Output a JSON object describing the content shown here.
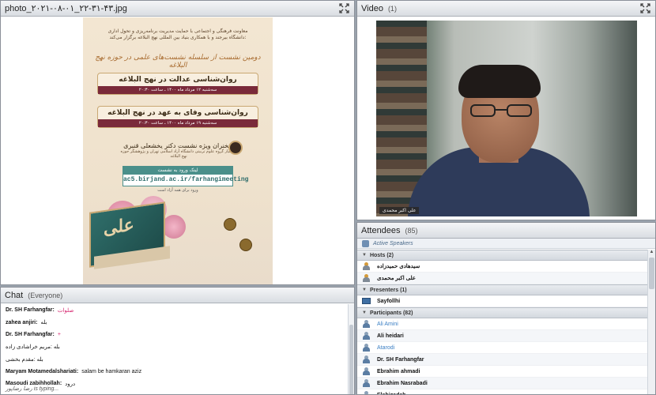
{
  "share_pod": {
    "title": "photo_۲۰۲۱-۰۸-۰۱_۲۲-۳۱-۴۳.jpg",
    "poster": {
      "header": "معاونت فرهنگی و اجتماعی با حمایت مدیریت برنامه‌ریزی و تحول اداری\nدانشگاه بیرجند و با همکاری بنیاد بین المللی نهج البلاغه برگزار می‌کند:",
      "main_title": "دومین نشست از سلسله نشست‌های علمی در حوزه نهج البلاغه",
      "talk1_title": "روان‌شناسی عدالت در نهج البلاغه",
      "talk1_date": "سه‌شنبه ۱۲ مرداد ماه ۱۴۰۰ ـ ساعت ۲۰:۳۰",
      "talk2_title": "روان‌شناسی وفای به عهد در نهج البلاغه",
      "talk2_date": "سه‌شنبه ۱۹ مرداد ماه ۱۴۰۰ ـ ساعت ۲۰:۳۰",
      "speaker": "سخنران ویژه نشست دکتر یخشعلی قنبری",
      "speaker_sub": "دانشیار گروه علوم تربیتی دانشگاه آزاد اسلامی تهران و پژوهشگر حوزه نهج البلاغه",
      "link_title": "لینک ورود به نشست",
      "link_url": "ac5.birjand.ac.ir/farhangimeeting",
      "link_note": "ورود برای همه آزاد است",
      "book_text": "علی"
    }
  },
  "video_pod": {
    "title": "Video",
    "count": "(1)",
    "name_tag": "علی اکبر محمدی"
  },
  "attendees_pod": {
    "title": "Attendees",
    "count": "(85)",
    "active_speakers": "Active Speakers",
    "groups": [
      {
        "label": "Hosts (2)",
        "users": [
          {
            "name": "سیدهادی حمیدزاده",
            "style": "host"
          },
          {
            "name": "علی اکبر محمدی",
            "style": "host"
          }
        ]
      },
      {
        "label": "Presenters (1)",
        "users": [
          {
            "name": "Sayfollhi",
            "style": "presenter"
          }
        ]
      },
      {
        "label": "Participants (82)",
        "users": [
          {
            "name": "Ali Amini",
            "style": "blue"
          },
          {
            "name": "Ali heidari",
            "style": "normal"
          },
          {
            "name": "Atarodi",
            "style": "blue"
          },
          {
            "name": "Dr. SH Farhangfar",
            "style": "normal"
          },
          {
            "name": "Ebrahim ahmadi",
            "style": "normal"
          },
          {
            "name": "Ebrahim Nasrabadi",
            "style": "normal"
          },
          {
            "name": "Elahizadeh",
            "style": "normal"
          }
        ]
      }
    ]
  },
  "chat_pod": {
    "title": "Chat",
    "scope": "(Everyone)",
    "messages": [
      {
        "who": "Dr. SH Farhangfar:",
        "text": "صلوات",
        "color": "pink"
      },
      {
        "who": "zahea anjiri:",
        "text": "بله",
        "color": "normal"
      },
      {
        "who": "Dr. SH Farhangfar:",
        "text": "+",
        "color": "pink"
      },
      {
        "who": "",
        "text": "بله :مریم خراشادی  زاده",
        "color": "normal"
      },
      {
        "who": "",
        "text": "بله :مقدم بخشی",
        "color": "normal"
      },
      {
        "who": "Maryam Motamedalshariati:",
        "text": "salam be hamkaran aziz",
        "color": "normal"
      },
      {
        "who": "Masoudi zabihhollah:",
        "text": "درود",
        "color": "normal"
      }
    ],
    "typing": "رضا رضاپور is typing..."
  },
  "colors": {
    "accent_blue": "#3b7fc4",
    "chat_pink": "#d6246e",
    "band_maroon": "#7a2a3a",
    "teal": "#4a8f8a"
  }
}
